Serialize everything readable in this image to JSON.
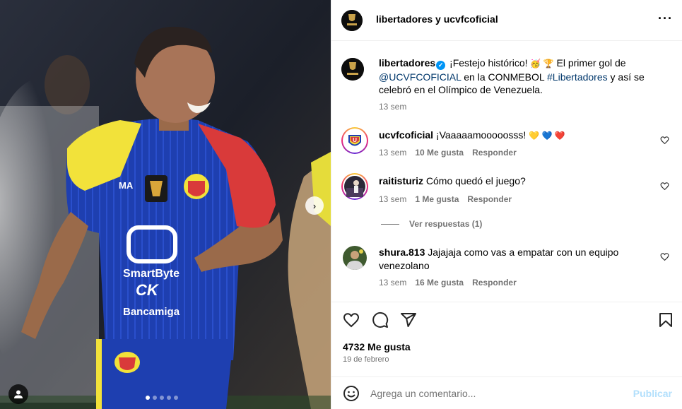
{
  "post": {
    "header_title": "libertadores y ucvfcoficial",
    "more_icon": "more-horizontal-icon"
  },
  "caption": {
    "username": "libertadores",
    "verified": true,
    "text_1": "¡Festejo histórico!",
    "text_2": "El primer gol de",
    "mention": "@UCVFCOFICIAL",
    "text_3": "en la CONMEBOL",
    "hashtag": "#Libertadores",
    "text_4": "y así se celebró en el Olímpico de Venezuela.",
    "time": "13 sem"
  },
  "comments": [
    {
      "username": "ucvfcoficial",
      "text": "¡Vaaaaamooooosss!",
      "emojis": "💛 💙 ❤️",
      "time": "13 sem",
      "likes": "10 Me gusta",
      "reply": "Responder"
    },
    {
      "username": "raitisturiz",
      "text": "Cómo quedó el juego?",
      "time": "13 sem",
      "likes": "1 Me gusta",
      "reply": "Responder",
      "view_replies": "Ver respuestas (1)"
    },
    {
      "username": "shura.813",
      "text": "Jajajaja como vas a empatar con un equipo venezolano",
      "time": "13 sem",
      "likes": "16 Me gusta",
      "reply": "Responder"
    }
  ],
  "jersey": {
    "sponsor_1": "SmartByte",
    "sponsor_2": "CK",
    "sponsor_3": "Bancamiga"
  },
  "stats": {
    "likes": "4732 Me gusta",
    "date": "19 de febrero"
  },
  "composer": {
    "placeholder": "Agrega un comentario...",
    "publish": "Publicar"
  },
  "carousel": {
    "slide_count": 5,
    "active_slide": 1
  },
  "colors": {
    "accent": "#0095f6",
    "link": "#00376b",
    "muted": "#737373",
    "publish_disabled": "#b2dffc",
    "jersey_blue": "#1e3fb0",
    "jersey_yellow": "#f2e23a",
    "jersey_red": "#d93a3a"
  }
}
